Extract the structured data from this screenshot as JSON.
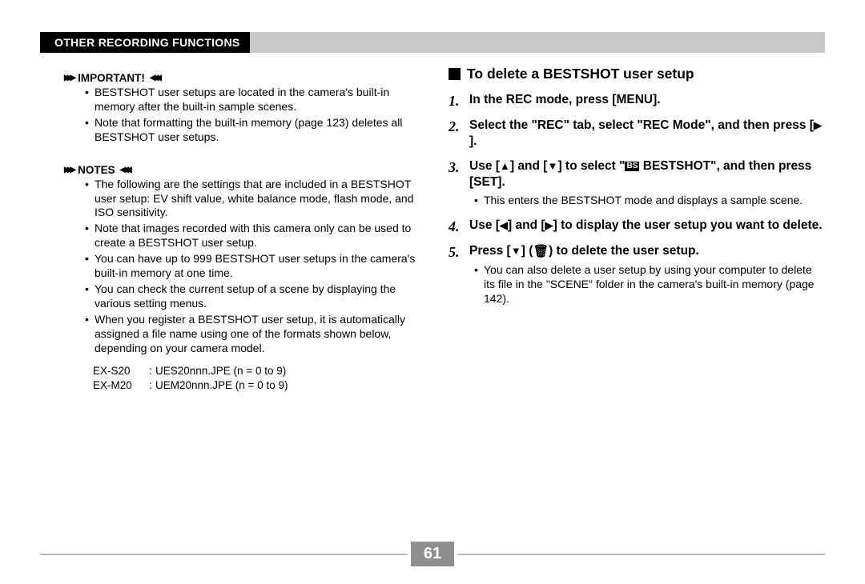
{
  "header": {
    "title": "OTHER RECORDING FUNCTIONS"
  },
  "left": {
    "important": {
      "label": "IMPORTANT!",
      "items": [
        "BESTSHOT user setups are located in the camera's built-in memory after the built-in sample scenes.",
        "Note that formatting the built-in memory (page 123) deletes all BESTSHOT user setups."
      ]
    },
    "notes": {
      "label": "NOTES",
      "items": [
        "The following are the settings that are included in a BESTSHOT user setup: EV shift value, white balance mode, flash mode, and ISO sensitivity.",
        "Note that images recorded with this camera only can be used to create a BESTSHOT user setup.",
        "You can have up to 999 BESTSHOT user setups in the camera's built-in memory at one time.",
        "You can check the current setup of a scene by displaying the various setting menus.",
        "When you register a BESTSHOT user setup, it is automatically assigned a file name using one of the formats shown below, depending on your camera model."
      ],
      "formats": [
        {
          "model": "EX-S20",
          "pattern": "UES20nnn.JPE (n = 0 to 9)"
        },
        {
          "model": "EX-M20",
          "pattern": "UEM20nnn.JPE (n = 0 to 9)"
        }
      ]
    }
  },
  "right": {
    "heading": "To delete a BESTSHOT user setup",
    "steps": {
      "s1": "In the REC mode, press [MENU].",
      "s2_a": "Select the \"REC\" tab, select \"REC Mode\", and then press [",
      "s2_b": "].",
      "s3_a": "Use [",
      "s3_b": "] and [",
      "s3_c": "] to select \"",
      "s3_d": " BESTSHOT\", and then press [SET].",
      "s3_sub": "This enters the BESTSHOT mode and displays a sample scene.",
      "s4_a": "Use [",
      "s4_b": "] and [",
      "s4_c": "] to display the user setup you want to delete.",
      "s5_a": "Press [",
      "s5_b": "] (",
      "s5_c": ") to delete the user setup.",
      "s5_sub": "You can also delete a user setup by using your computer to delete its file in the \"SCENE\" folder in the camera's built-in memory (page 142)."
    }
  },
  "page": "61"
}
